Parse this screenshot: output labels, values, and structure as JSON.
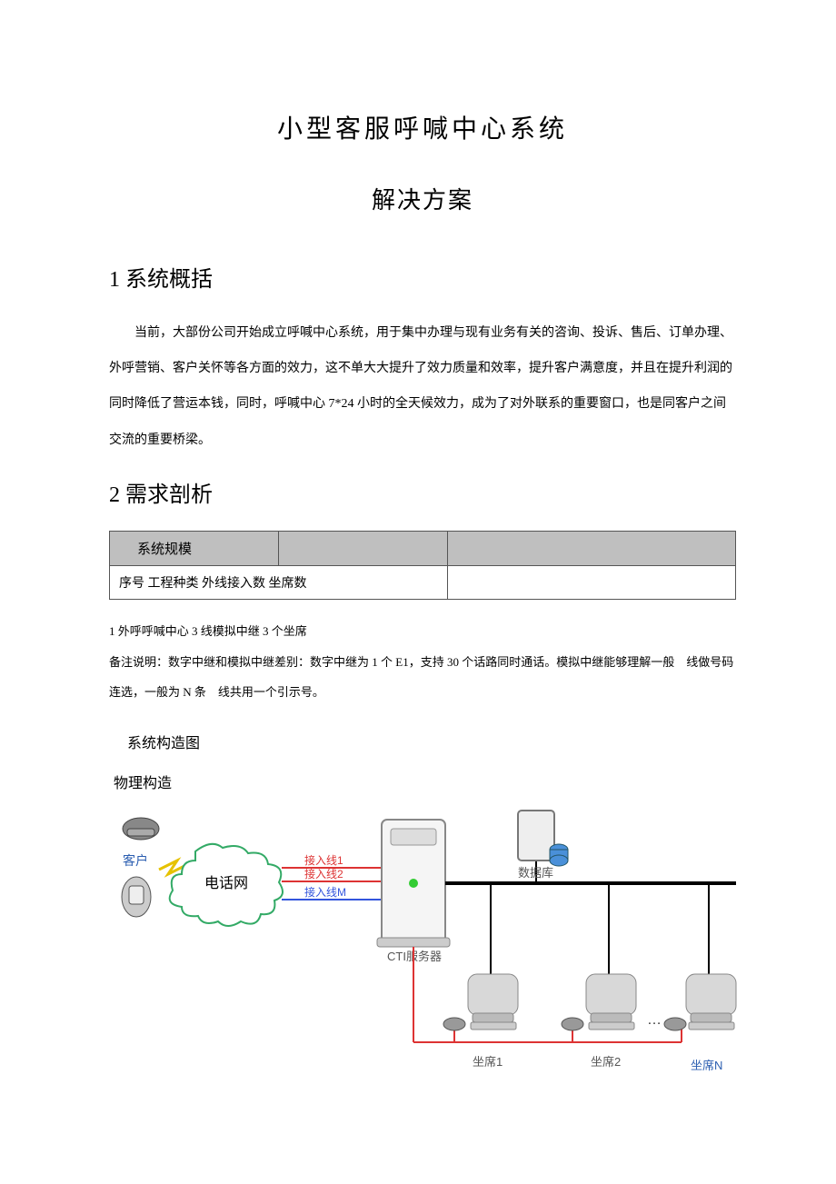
{
  "title": "小型客服呼喊中心系统",
  "subtitle": "解决方案",
  "section1": {
    "heading": "1 系统概括",
    "paragraph": "当前，大部份公司开始成立呼喊中心系统，用于集中办理与现有业务有关的咨询、投诉、售后、订单办理、外呼营销、客户关怀等各方面的效力，这不单大大提升了效力质量和效率，提升客户满意度，并且在提升利润的同时降低了营运本钱，同时，呼喊中心 7*24 小时的全天候效力，成为了对外联系的重要窗口，也是同客户之间交流的重要桥梁。"
  },
  "section2": {
    "heading": "2 需求剖析",
    "table": {
      "groupHeader": "系统规模",
      "columns": "序号 工程种类 外线接入数 坐席数",
      "row1": "1 外呼呼喊中心 3 线模拟中继 3 个坐席",
      "note": "备注说明：数字中继和模拟中继差别：数字中继为 1 个 E1，支持 30 个话路同时通话。模拟中继能够理解一般　线做号码连选，一般为 N 条　线共用一个引示号。"
    },
    "structHeading": "系统构造图",
    "physHeading": "物理构造",
    "diagram": {
      "customer": "客户",
      "pstn": "电话网",
      "line1": "接入线1",
      "line2": "接入线2",
      "lineM": "接入线M",
      "cti": "CTI服务器",
      "db": "数据库",
      "agent1": "坐席1",
      "agent2": "坐席2",
      "agentN": "坐席N"
    }
  }
}
